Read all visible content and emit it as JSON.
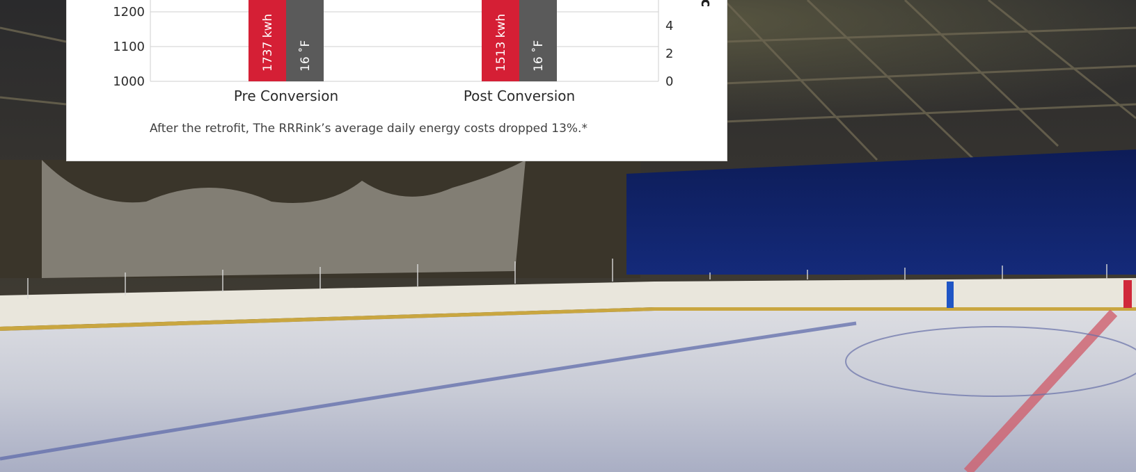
{
  "colors": {
    "energy_bar": "#d51f35",
    "temp_bar": "#5a5a5a",
    "grid": "#cfcfcf",
    "card_bg": "#ffffff"
  },
  "caption": "After the retrofit, The RRRink’s average daily energy costs dropped 13%.*",
  "chart_data": {
    "type": "bar",
    "categories": [
      "Pre Conversion",
      "Post Conversion"
    ],
    "series": [
      {
        "values": [
          1737,
          1513
        ],
        "value_labels": [
          "1737 kwh",
          "1513 kwh"
        ],
        "axis": "left"
      },
      {
        "values": [
          16,
          16
        ],
        "value_labels": [
          "16 ˚F",
          "16 ˚F"
        ],
        "axis": "right"
      }
    ],
    "left_axis": {
      "visible_ticks": [
        1000,
        1100,
        1200
      ]
    },
    "right_axis": {
      "visible_ticks": [
        0,
        2,
        4
      ],
      "title_fragment": "Ic"
    },
    "grid": true
  }
}
